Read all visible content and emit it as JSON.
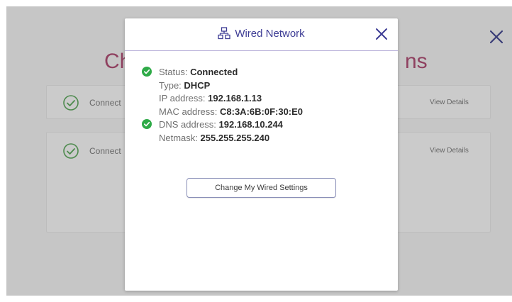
{
  "background": {
    "title_left_fragment": "Ch",
    "title_right_fragment": "ns",
    "cards": [
      {
        "label": "Connect",
        "action": "View Details"
      },
      {
        "label": "Connect",
        "action": "View Details"
      }
    ]
  },
  "modal": {
    "title": "Wired Network",
    "icon": "wired-network-icon",
    "details": [
      {
        "label": "Status:",
        "value": "Connected",
        "ok": true
      },
      {
        "label": "Type:",
        "value": "DHCP",
        "ok": false
      },
      {
        "label": "IP address:",
        "value": "192.168.1.13",
        "ok": false
      },
      {
        "label": "MAC address:",
        "value": "C8:3A:6B:0F:30:E0",
        "ok": false
      },
      {
        "label": "DNS address:",
        "value": "192.168.10.244",
        "ok": true
      },
      {
        "label": "Netmask:",
        "value": "255.255.255.240",
        "ok": false
      }
    ],
    "button_label": "Change My Wired Settings"
  },
  "colors": {
    "accent": "#3e3d95",
    "success": "#2eaa47",
    "background_title": "#8f4160",
    "overlay": "#c6c6c6"
  }
}
